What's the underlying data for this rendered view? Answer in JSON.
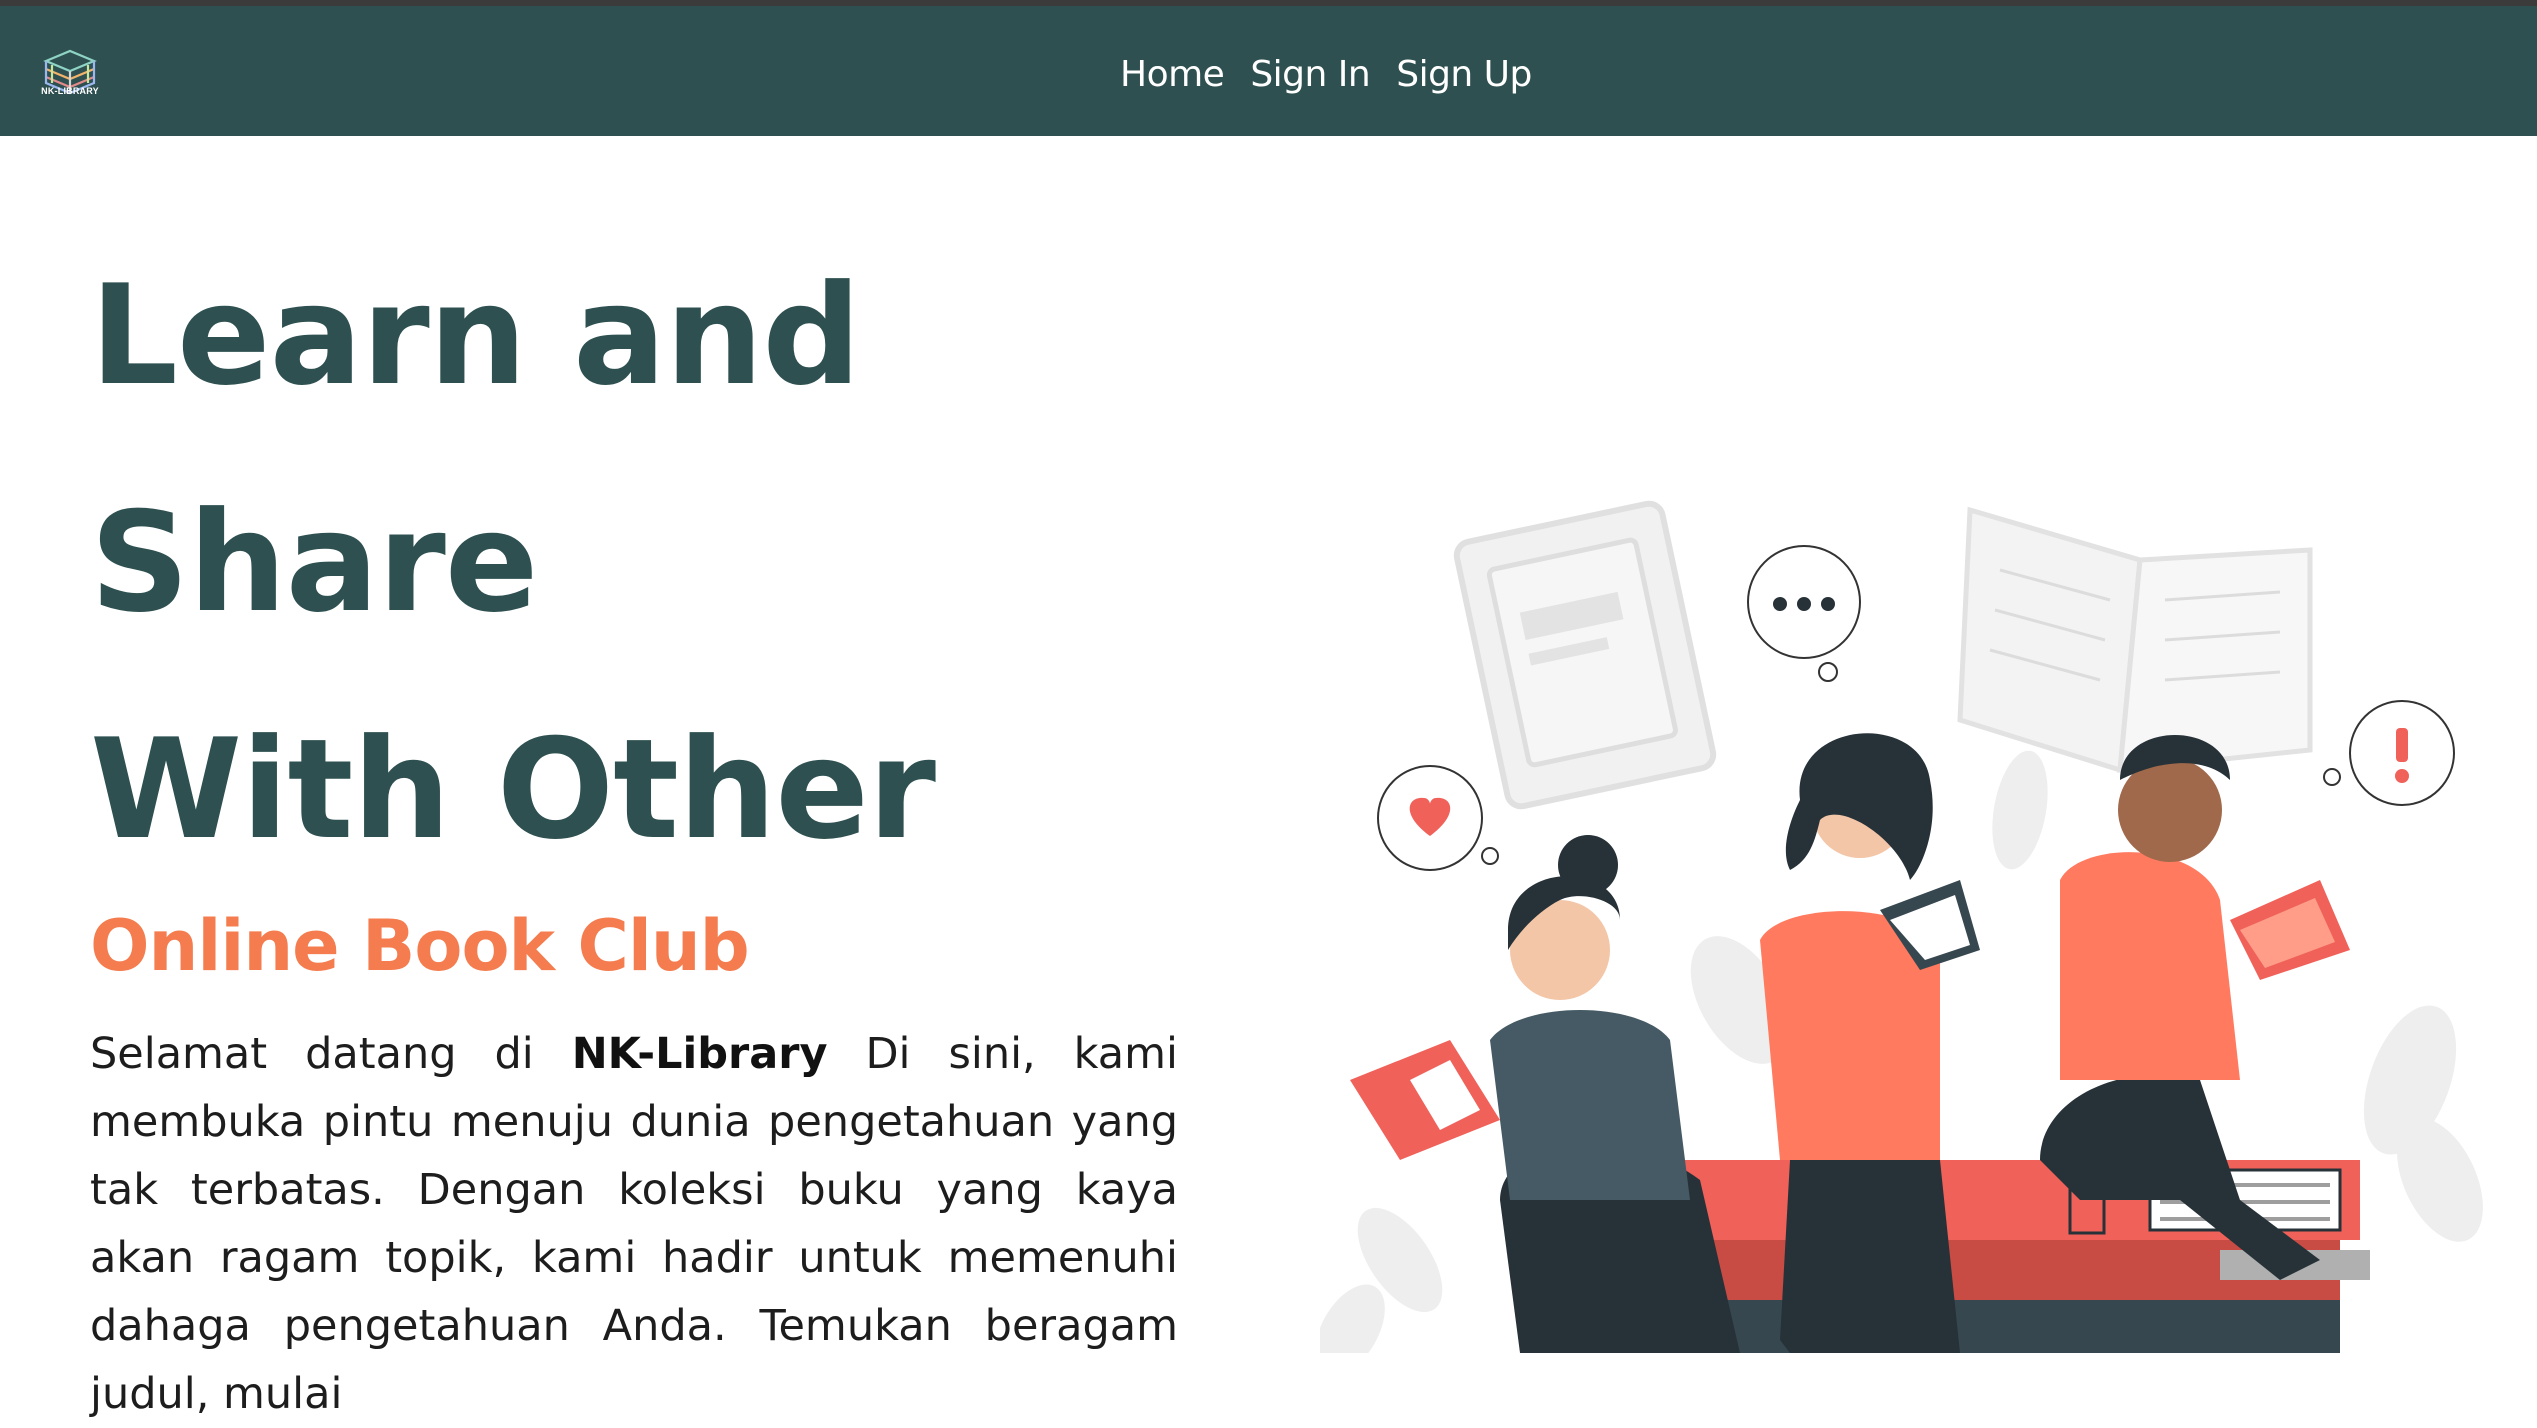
{
  "navbar": {
    "logo_text": "NK-LIBRARY",
    "links": [
      {
        "label": "Home"
      },
      {
        "label": "Sign In"
      },
      {
        "label": "Sign Up"
      }
    ]
  },
  "hero": {
    "title_lines": [
      "Learn and",
      "Share",
      "With Other"
    ],
    "subtitle": "Online Book Club",
    "intro_start": "Selamat datang di ",
    "intro_brand": "NK-Library",
    "intro_rest": " Di sini, kami membuka pintu menuju dunia pengetahuan yang tak terbatas. Dengan koleksi buku yang kaya akan ragam topik, kami hadir untuk memenuhi dahaga pengetahuan Anda. Temukan beragam judul, mulai"
  },
  "colors": {
    "navbar": "#2e5050",
    "title": "#2e5050",
    "accent": "#f47c4e",
    "body_text": "#1d1d1d"
  },
  "icons": {
    "logo": "stacked-books-logo-icon",
    "illustration": "people-reading-books-illustration"
  }
}
